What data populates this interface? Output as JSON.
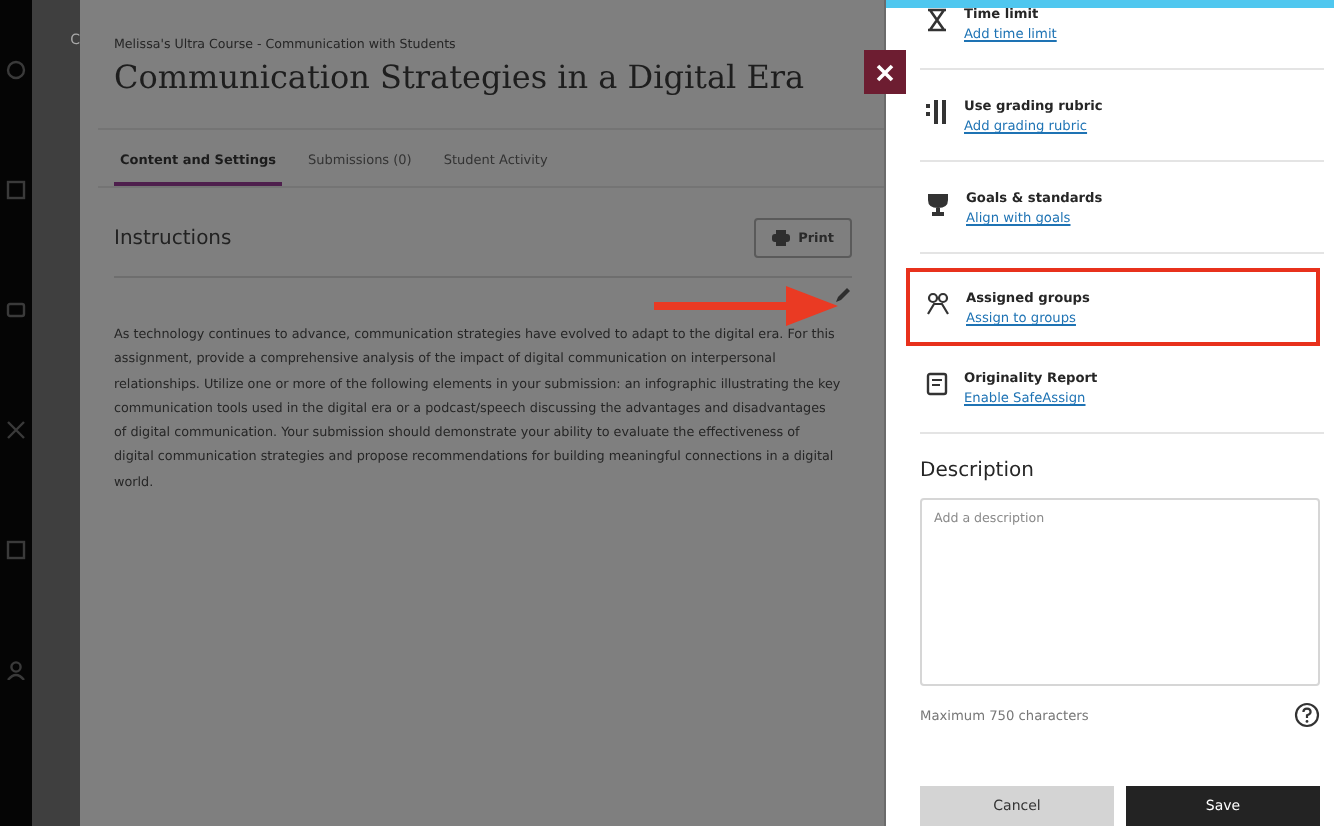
{
  "course_tab": "C",
  "breadcrumb": "Melissa's Ultra Course - Communication with Students",
  "title": "Communication Strategies in a Digital Era",
  "tabs": [
    {
      "label": "Content and Settings",
      "selected": true
    },
    {
      "label": "Submissions (0)",
      "selected": false
    },
    {
      "label": "Student Activity",
      "selected": false
    }
  ],
  "instructions": {
    "heading": "Instructions",
    "print": "Print",
    "text": "As technology continues to advance, communication strategies have evolved to adapt to the digital era. For this assignment, provide a comprehensive analysis of the impact of digital communication on interpersonal relationships. Utilize one or more of the following elements in your submission: an infographic illustrating the key communication tools used in the digital era or a podcast/speech discussing the advantages and disadvantages of digital communication. Your submission should demonstrate your ability to evaluate the effectiveness of digital communication strategies and propose recommendations for building meaningful connections in a digital world."
  },
  "settings": [
    {
      "title": "Time limit",
      "link": "Add time limit",
      "highlighted": false
    },
    {
      "title": "Use grading rubric",
      "link": "Add grading rubric",
      "highlighted": false
    },
    {
      "title": "Goals & standards",
      "link": "Align with goals",
      "highlighted": false
    },
    {
      "title": "Assigned groups",
      "link": "Assign to groups",
      "highlighted": true
    },
    {
      "title": "Originality Report",
      "link": "Enable SafeAssign",
      "highlighted": false
    }
  ],
  "description": {
    "heading": "Description",
    "placeholder": "Add a description",
    "limit": "Maximum 750 characters"
  },
  "buttons": {
    "cancel": "Cancel",
    "save": "Save"
  }
}
